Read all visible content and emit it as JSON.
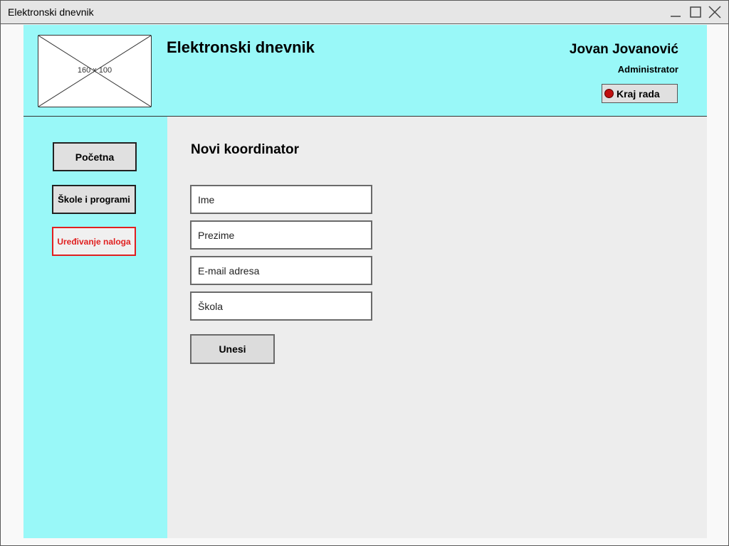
{
  "window": {
    "title": "Elektronski dnevnik",
    "controls": [
      "minimize-icon",
      "maximize-icon",
      "close-icon"
    ]
  },
  "header": {
    "logo_placeholder": "160 x 100",
    "app_title": "Elektronski dnevnik",
    "user_name": "Jovan Jovanović",
    "user_role": "Administrator",
    "logout_label": "Kraj rada",
    "logout_icon": "stop-circle-icon"
  },
  "sidebar": {
    "items": [
      {
        "label": "Početna",
        "active": false
      },
      {
        "label": "Škole i programi",
        "active": false
      },
      {
        "label": "Uređivanje naloga",
        "active": true
      }
    ]
  },
  "main": {
    "title": "Novi koordinator",
    "fields": [
      {
        "placeholder": "Ime",
        "value": ""
      },
      {
        "placeholder": "Prezime",
        "value": ""
      },
      {
        "placeholder": "E-mail adresa",
        "value": ""
      },
      {
        "placeholder": "Škola",
        "value": ""
      }
    ],
    "submit_label": "Unesi"
  },
  "colors": {
    "header_bg": "#99f8f8",
    "main_bg": "#ededed",
    "active_nav": "#e02020",
    "logout_dot": "#c01010"
  }
}
